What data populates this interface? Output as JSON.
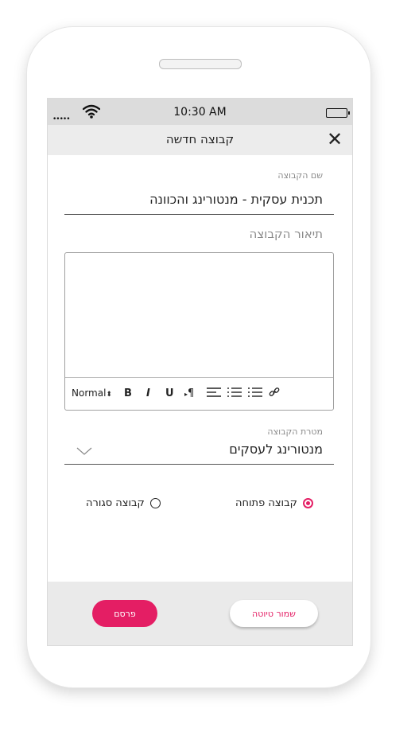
{
  "status_bar": {
    "signal": "•••••",
    "time": "10:30 AM",
    "wifi_icon": "wifi-icon",
    "battery_icon": "battery-icon"
  },
  "header": {
    "title": "קבוצה חדשה",
    "close_icon": "close-icon"
  },
  "form": {
    "group_name": {
      "label": "שם הקבוצה",
      "value": "תכנית עסקית - מנטורינג והכוונה"
    },
    "description": {
      "label": "תיאור הקבוצה",
      "value": ""
    },
    "toolbar": {
      "format_select": "Normal",
      "bold": "B",
      "italic": "I",
      "underline": "U",
      "paragraph": "¶"
    },
    "purpose": {
      "label": "מטרת הקבוצה",
      "value": "מנטורינג לעסקים"
    },
    "visibility": {
      "options": [
        {
          "label": "קבוצה פתוחה",
          "selected": true
        },
        {
          "label": "קבוצה סגורה",
          "selected": false
        }
      ]
    }
  },
  "footer": {
    "publish_label": "פרסם",
    "draft_label": "שמור טיוטה"
  },
  "colors": {
    "accent": "#e41e64",
    "header_bg": "#ececec",
    "status_bg": "#dcdcdc",
    "footer_bg": "#eaeaea"
  }
}
